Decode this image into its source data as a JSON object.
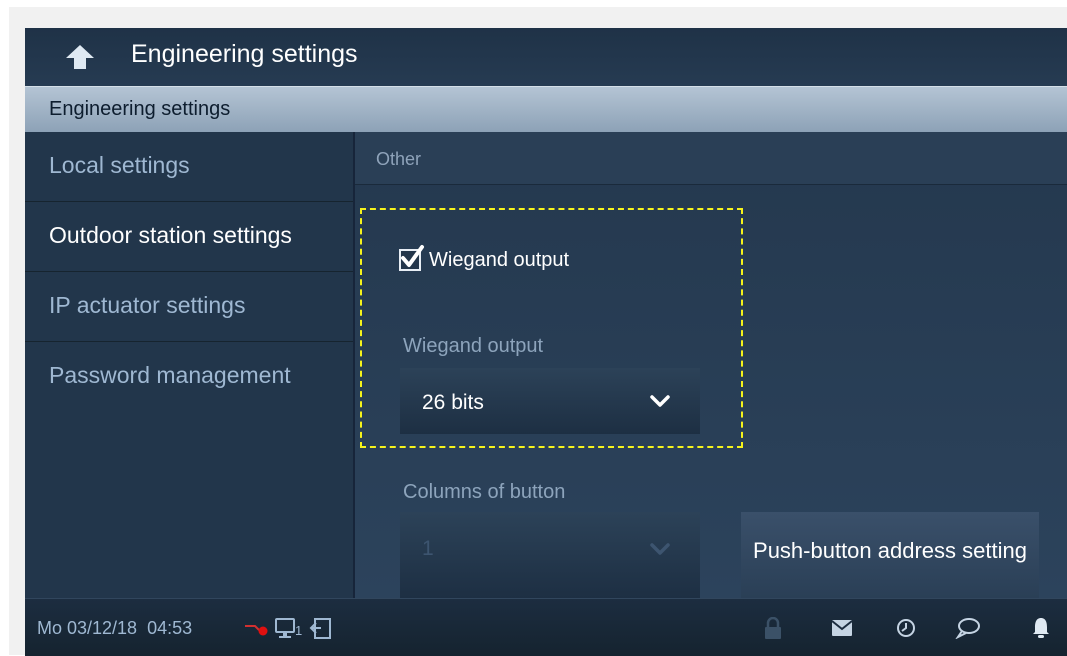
{
  "window": {
    "title": "Engineering settings"
  },
  "section": {
    "title": "Engineering settings"
  },
  "sidebar": {
    "items": [
      {
        "label": "Local settings",
        "state": "dim"
      },
      {
        "label": "Outdoor station settings",
        "state": "active"
      },
      {
        "label": "IP actuator settings",
        "state": "dim"
      },
      {
        "label": "Password management",
        "state": "dim"
      }
    ]
  },
  "content": {
    "header": "Other",
    "wiegand_checkbox": {
      "label": "Wiegand output",
      "checked": true
    },
    "wiegand_select": {
      "label": "Wiegand output",
      "value": "26 bits"
    },
    "columns_select": {
      "label": "Columns of button",
      "value": "1",
      "enabled": false
    },
    "push_button": {
      "label": "Push-button address setting"
    }
  },
  "status": {
    "datetime": "Mo 03/12/18  04:53",
    "indicator_number": "1",
    "icons": [
      "lock-icon",
      "mail-icon",
      "history-icon",
      "chat-icon",
      "bell-icon"
    ]
  },
  "colors": {
    "highlight_border": "#f5f31c",
    "background": "#23364b",
    "section_bar": "#a3b5c7",
    "alert_dot": "#e01010"
  }
}
